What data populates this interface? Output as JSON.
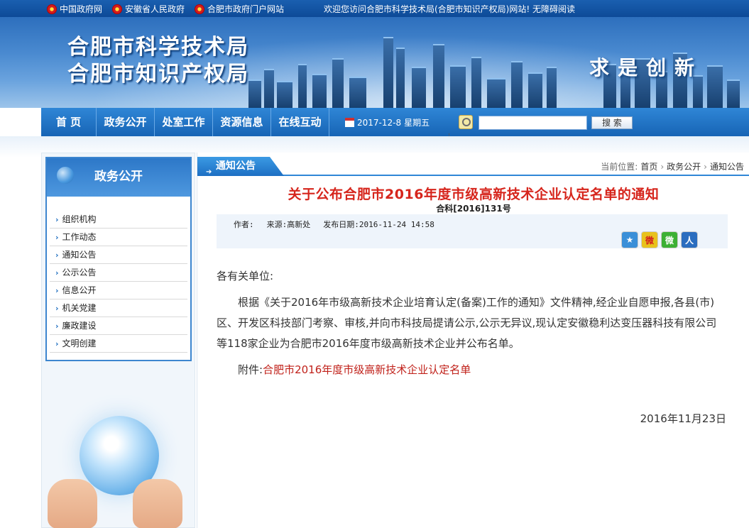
{
  "topbar": {
    "links": [
      "中国政府网",
      "安徽省人民政府",
      "合肥市政府门户网站"
    ],
    "welcome": "欢迎您访问合肥市科学技术局(合肥市知识产权局)网站! 无障碍阅读"
  },
  "banner": {
    "title_line1": "合肥市科学技术局",
    "title_line2": "合肥市知识产权局",
    "slogan": "求是创新"
  },
  "nav": {
    "items": [
      "首  页",
      "政务公开",
      "处室工作",
      "资源信息",
      "在线互动"
    ],
    "date": "2017-12-8",
    "weekday": "星期五",
    "search_placeholder": "",
    "search_button": "搜  索"
  },
  "sidebar": {
    "title": "政务公开",
    "items": [
      "组织机构",
      "工作动态",
      "通知公告",
      "公示公告",
      "信息公开",
      "机关党建",
      "廉政建设",
      "文明创建"
    ]
  },
  "main": {
    "tab_label": "通知公告",
    "breadcrumb_prefix": "当前位置:",
    "breadcrumb": [
      "首页",
      "政务公开",
      "通知公告"
    ],
    "title": "关于公布合肥市2016年度市级高新技术企业认定名单的通知",
    "doc_no": "合科[2016]131号",
    "meta": {
      "author": "作者:",
      "source": "来源:高新处",
      "published": "发布日期:2016-11-24 14:58"
    },
    "share_icons": [
      "favorite-icon",
      "weibo-icon",
      "wechat-icon",
      "renren-icon"
    ],
    "salutation": "各有关单位:",
    "paragraph": "根据《关于2016年市级高新技术企业培育认定(备案)工作的通知》文件精神,经企业自愿申报,各县(市)区、开发区科技部门考察、审核,并向市科技局提请公示,公示无异议,现认定安徽稳利达变压器科技有限公司等118家企业为合肥市2016年度市级高新技术企业并公布名单。",
    "attachment_prefix": "附件:",
    "attachment_link": "合肥市2016年度市级高新技术企业认定名单",
    "sign_date": "2016年11月23日"
  },
  "colors": {
    "nav_blue": "#1f6fc3",
    "title_red": "#d6251c",
    "link_red": "#c0211a"
  }
}
